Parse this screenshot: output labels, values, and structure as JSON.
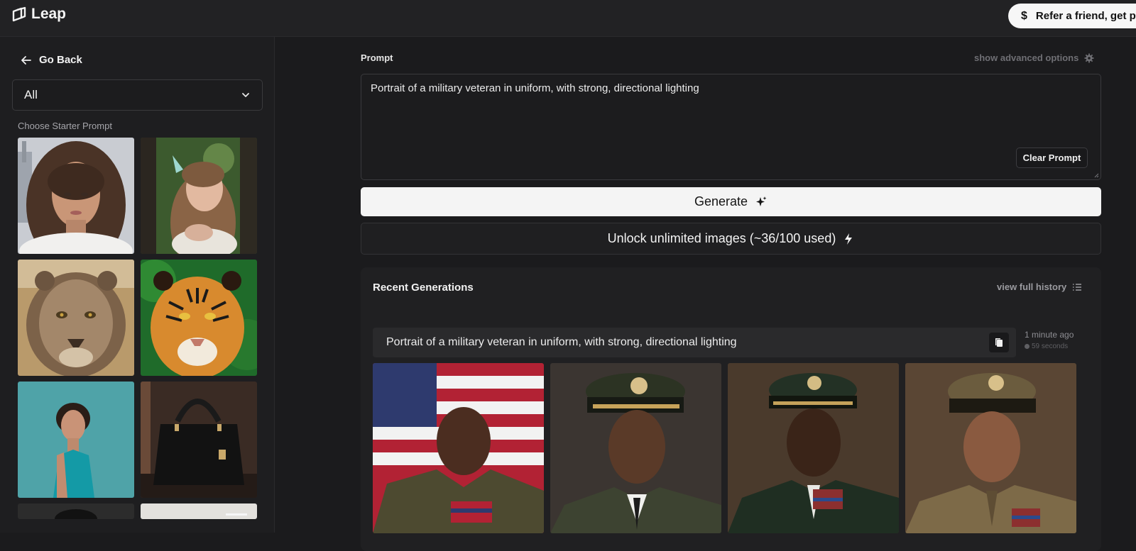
{
  "app": {
    "name": "Leap",
    "refer_label": "Refer a friend, get p"
  },
  "sidebar": {
    "go_back_label": "Go Back",
    "category_select": {
      "value": "All"
    },
    "starter_label": "Choose Starter Prompt",
    "starters": [
      {
        "subject": "woman portrait with city background"
      },
      {
        "subject": "fairy girl in forest"
      },
      {
        "subject": "lioness"
      },
      {
        "subject": "tiger"
      },
      {
        "subject": "woman in teal dress"
      },
      {
        "subject": "black handbag"
      },
      {
        "subject": "partially visible portrait"
      },
      {
        "subject": "partially visible interior"
      }
    ]
  },
  "prompt": {
    "label": "Prompt",
    "advanced_label": "show advanced options",
    "value": "Portrait of a military veteran in uniform, with strong, directional lighting",
    "clear_label": "Clear Prompt",
    "generate_label": "Generate",
    "unlock_label": "Unlock unlimited images (~36/100 used)"
  },
  "recent": {
    "title": "Recent Generations",
    "history_label": "view full history",
    "generation": {
      "prompt": "Portrait of a military veteran in uniform, with strong, directional lighting",
      "time_ago": "1 minute ago",
      "duration": "59 seconds",
      "images": [
        {
          "subject": "veteran with american flag"
        },
        {
          "subject": "officer with peaked cap"
        },
        {
          "subject": "officer in dark green uniform"
        },
        {
          "subject": "officer in khaki uniform"
        }
      ]
    }
  }
}
